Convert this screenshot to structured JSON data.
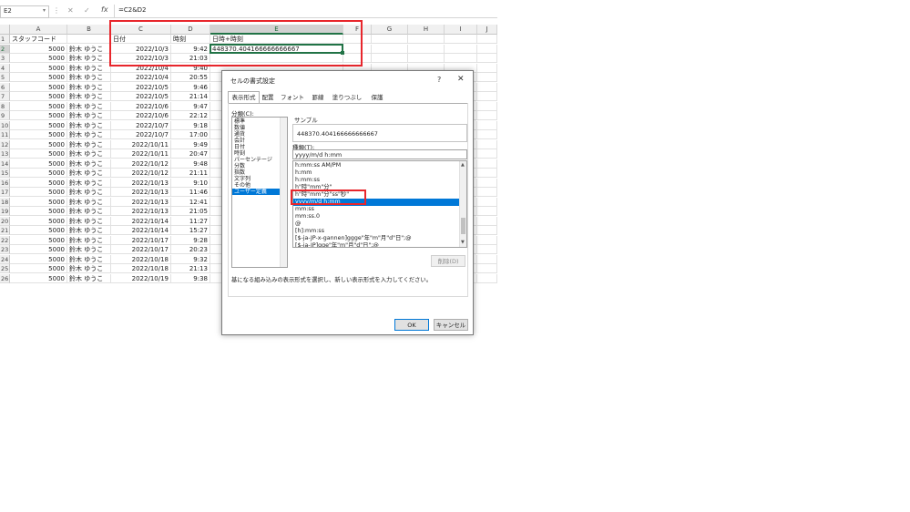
{
  "formula_bar": {
    "name_box": "E2",
    "cancel_glyph": "✕",
    "enter_glyph": "✓",
    "fx_label": "fx",
    "formula": "=C2&D2"
  },
  "columns": [
    "A",
    "B",
    "C",
    "D",
    "E",
    "F",
    "G",
    "H",
    "I",
    "J"
  ],
  "rows": [
    {
      "n": "1",
      "a": "スタッフコード",
      "b": "",
      "c": "日付",
      "d": "時刻",
      "e": "日時+時刻"
    },
    {
      "n": "2",
      "a": "5000",
      "b": "鈴木 ゆうこ",
      "c": "2022/10/3",
      "d": "9:42",
      "e": "448370.404166666666667"
    },
    {
      "n": "3",
      "a": "5000",
      "b": "鈴木 ゆうこ",
      "c": "2022/10/3",
      "d": "21:03",
      "e": ""
    },
    {
      "n": "4",
      "a": "5000",
      "b": "鈴木 ゆうこ",
      "c": "2022/10/4",
      "d": "9:40",
      "e": ""
    },
    {
      "n": "5",
      "a": "5000",
      "b": "鈴木 ゆうこ",
      "c": "2022/10/4",
      "d": "20:55",
      "e": ""
    },
    {
      "n": "6",
      "a": "5000",
      "b": "鈴木 ゆうこ",
      "c": "2022/10/5",
      "d": "9:46",
      "e": ""
    },
    {
      "n": "7",
      "a": "5000",
      "b": "鈴木 ゆうこ",
      "c": "2022/10/5",
      "d": "21:14",
      "e": ""
    },
    {
      "n": "8",
      "a": "5000",
      "b": "鈴木 ゆうこ",
      "c": "2022/10/6",
      "d": "9:47",
      "e": ""
    },
    {
      "n": "9",
      "a": "5000",
      "b": "鈴木 ゆうこ",
      "c": "2022/10/6",
      "d": "22:12",
      "e": ""
    },
    {
      "n": "10",
      "a": "5000",
      "b": "鈴木 ゆうこ",
      "c": "2022/10/7",
      "d": "9:18",
      "e": ""
    },
    {
      "n": "11",
      "a": "5000",
      "b": "鈴木 ゆうこ",
      "c": "2022/10/7",
      "d": "17:00",
      "e": ""
    },
    {
      "n": "12",
      "a": "5000",
      "b": "鈴木 ゆうこ",
      "c": "2022/10/11",
      "d": "9:49",
      "e": ""
    },
    {
      "n": "13",
      "a": "5000",
      "b": "鈴木 ゆうこ",
      "c": "2022/10/11",
      "d": "20:47",
      "e": ""
    },
    {
      "n": "14",
      "a": "5000",
      "b": "鈴木 ゆうこ",
      "c": "2022/10/12",
      "d": "9:48",
      "e": ""
    },
    {
      "n": "15",
      "a": "5000",
      "b": "鈴木 ゆうこ",
      "c": "2022/10/12",
      "d": "21:11",
      "e": ""
    },
    {
      "n": "16",
      "a": "5000",
      "b": "鈴木 ゆうこ",
      "c": "2022/10/13",
      "d": "9:10",
      "e": ""
    },
    {
      "n": "17",
      "a": "5000",
      "b": "鈴木 ゆうこ",
      "c": "2022/10/13",
      "d": "11:46",
      "e": ""
    },
    {
      "n": "18",
      "a": "5000",
      "b": "鈴木 ゆうこ",
      "c": "2022/10/13",
      "d": "12:41",
      "e": ""
    },
    {
      "n": "19",
      "a": "5000",
      "b": "鈴木 ゆうこ",
      "c": "2022/10/13",
      "d": "21:05",
      "e": ""
    },
    {
      "n": "20",
      "a": "5000",
      "b": "鈴木 ゆうこ",
      "c": "2022/10/14",
      "d": "11:27",
      "e": ""
    },
    {
      "n": "21",
      "a": "5000",
      "b": "鈴木 ゆうこ",
      "c": "2022/10/14",
      "d": "15:27",
      "e": ""
    },
    {
      "n": "22",
      "a": "5000",
      "b": "鈴木 ゆうこ",
      "c": "2022/10/17",
      "d": "9:28",
      "e": ""
    },
    {
      "n": "23",
      "a": "5000",
      "b": "鈴木 ゆうこ",
      "c": "2022/10/17",
      "d": "20:23",
      "e": ""
    },
    {
      "n": "24",
      "a": "5000",
      "b": "鈴木 ゆうこ",
      "c": "2022/10/18",
      "d": "9:32",
      "e": ""
    },
    {
      "n": "25",
      "a": "5000",
      "b": "鈴木 ゆうこ",
      "c": "2022/10/18",
      "d": "21:13",
      "e": ""
    },
    {
      "n": "26",
      "a": "5000",
      "b": "鈴木 ゆうこ",
      "c": "2022/10/19",
      "d": "9:38",
      "e": ""
    }
  ],
  "dialog": {
    "title": "セルの書式設定",
    "help": "?",
    "close": "✕",
    "tabs": [
      "表示形式",
      "配置",
      "フォント",
      "罫線",
      "塗りつぶし",
      "保護"
    ],
    "active_tab": "表示形式",
    "category_label": "分類(C):",
    "categories": [
      "標準",
      "数値",
      "通貨",
      "会計",
      "日付",
      "時刻",
      "パーセンテージ",
      "分数",
      "指数",
      "文字列",
      "その他",
      "ユーザー定義"
    ],
    "selected_category": "ユーザー定義",
    "sample_label": "サンプル",
    "sample_value": "448370.404166666666667",
    "type_label": "種類(T):",
    "type_value": "yyyy/m/d h:mm",
    "formats": [
      "h:mm:ss AM/PM",
      "h:mm",
      "h:mm:ss",
      "h\"時\"mm\"分\"",
      "h\"時\"mm\"分\"ss\"秒\"",
      "yyyy/m/d h:mm",
      "mm:ss",
      "mm:ss.0",
      "@",
      "[h]:mm:ss",
      "[$-ja-JP-x-gannen]ggge\"年\"m\"月\"d\"日\";@",
      "[$-ja-JP]gge\"年\"m\"月\"d\"日\";@"
    ],
    "selected_format": "yyyy/m/d h:mm",
    "delete_label": "削除(D)",
    "hint": "基になる組み込みの表示形式を選択し、新しい表示形式を入力してください。",
    "ok_label": "OK",
    "cancel_label": "キャンセル"
  },
  "colors": {
    "selection_green": "#217346",
    "highlight_red": "#e8262c",
    "list_selection": "#0078d7"
  }
}
